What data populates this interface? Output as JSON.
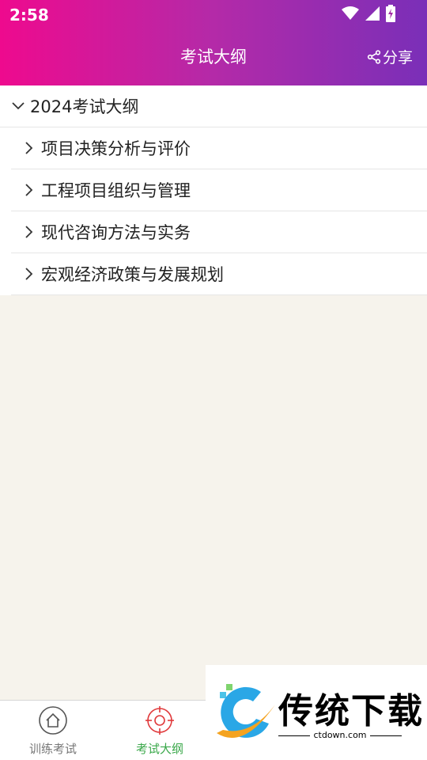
{
  "status_bar": {
    "time": "2:58"
  },
  "header": {
    "title": "考试大纲",
    "share_label": "分享"
  },
  "outline": {
    "group_label": "2024考试大纲",
    "items": [
      {
        "label": "项目决策分析与评价"
      },
      {
        "label": "工程项目组织与管理"
      },
      {
        "label": "现代咨询方法与实务"
      },
      {
        "label": "宏观经济政策与发展规划"
      }
    ]
  },
  "bottom_nav": {
    "items": [
      {
        "label": "训练考试",
        "icon": "home-icon"
      },
      {
        "label": "考试大纲",
        "icon": "target-icon"
      }
    ],
    "active_color": "#3aa84a",
    "active_icon_color": "#e0393b"
  },
  "watermark": {
    "brand": "传统下载",
    "url": "ctdown.com"
  },
  "colors": {
    "header_start": "#ee0a8e",
    "header_end": "#7a2fb8",
    "background": "#f6f3ec"
  }
}
